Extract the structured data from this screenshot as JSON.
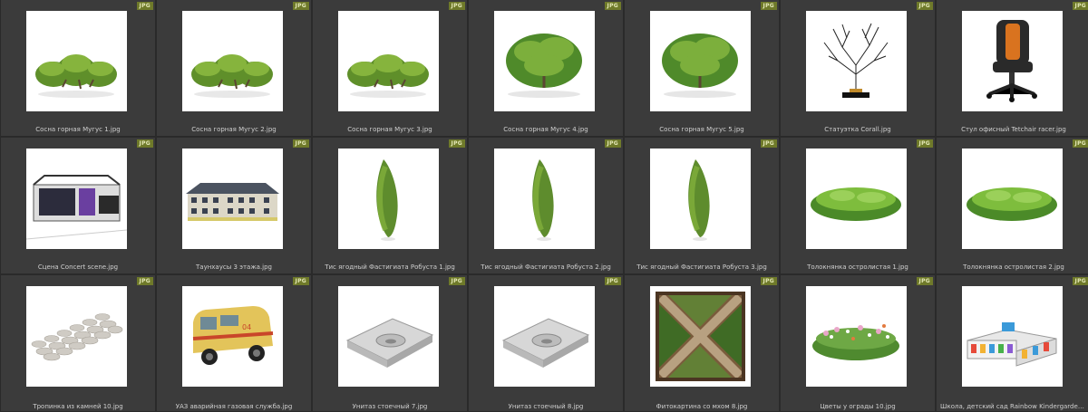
{
  "items": [
    {
      "name": "Сосна горная Mугус 1.jpg",
      "badge": "JPG",
      "kind": "pine-bush",
      "icon": "pine-bush-icon"
    },
    {
      "name": "Сосна горная Mугус 2.jpg",
      "badge": "JPG",
      "kind": "pine-bush",
      "icon": "pine-bush-icon"
    },
    {
      "name": "Сосна горная Mугус 3.jpg",
      "badge": "JPG",
      "kind": "pine-bush",
      "icon": "pine-bush-icon"
    },
    {
      "name": "Сосна горная Mугус 4.jpg",
      "badge": "JPG",
      "kind": "round-bush",
      "icon": "round-bush-icon"
    },
    {
      "name": "Сосна горная Mугус 5.jpg",
      "badge": "JPG",
      "kind": "round-bush",
      "icon": "round-bush-icon"
    },
    {
      "name": "Статуэтка Corall.jpg",
      "badge": "JPG",
      "kind": "coral",
      "icon": "coral-statuette-icon"
    },
    {
      "name": "Стул офисный Tetchair racer.jpg",
      "badge": "JPG",
      "kind": "chair",
      "icon": "office-chair-icon"
    },
    {
      "name": "Сцена Concert scene.jpg",
      "badge": "JPG",
      "kind": "stage",
      "icon": "concert-stage-icon"
    },
    {
      "name": "Таунхаусы 3 этажа.jpg",
      "badge": "JPG",
      "kind": "townhouse",
      "icon": "townhouse-icon"
    },
    {
      "name": "Тис ягодный Фастигиата Робуста 1.jpg",
      "badge": "JPG",
      "kind": "columnar",
      "icon": "columnar-tree-icon"
    },
    {
      "name": "Тис ягодный Фастигиата Робуста 2.jpg",
      "badge": "JPG",
      "kind": "columnar",
      "icon": "columnar-tree-icon"
    },
    {
      "name": "Тис ягодный Фастигиата Робуста 3.jpg",
      "badge": "JPG",
      "kind": "columnar",
      "icon": "columnar-tree-icon"
    },
    {
      "name": "Толокнянка остролистая 1.jpg",
      "badge": "JPG",
      "kind": "groundcover",
      "icon": "groundcover-icon"
    },
    {
      "name": "Толокнянка остролистая 2.jpg",
      "badge": "JPG",
      "kind": "groundcover",
      "icon": "groundcover-icon"
    },
    {
      "name": "Тропинка из камней 10.jpg",
      "badge": "JPG",
      "kind": "stones",
      "icon": "stone-path-icon"
    },
    {
      "name": "УАЗ аварийная газовая служба.jpg",
      "badge": "JPG",
      "kind": "van",
      "icon": "van-icon"
    },
    {
      "name": "Унитаз стоечный 7.jpg",
      "badge": "JPG",
      "kind": "toilet",
      "icon": "squat-toilet-icon"
    },
    {
      "name": "Унитаз стоечный 8.jpg",
      "badge": "JPG",
      "kind": "toilet",
      "icon": "squat-toilet-icon"
    },
    {
      "name": "Фитокартина со мхом 8.jpg",
      "badge": "JPG",
      "kind": "moss",
      "icon": "moss-panel-icon"
    },
    {
      "name": "Цветы у ограды 10.jpg",
      "badge": "JPG",
      "kind": "flowers",
      "icon": "flowerbed-icon"
    },
    {
      "name": "Школа, детский сад Rainbow Kindergarden.jpg",
      "badge": "JPG",
      "kind": "school",
      "icon": "school-icon"
    }
  ]
}
